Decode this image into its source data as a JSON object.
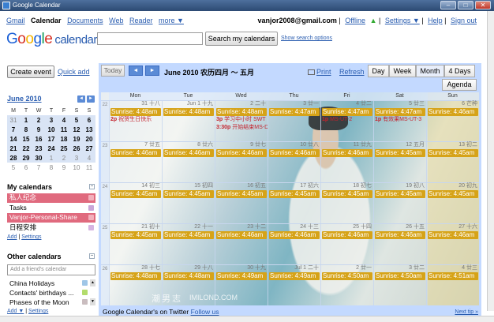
{
  "window": {
    "title": "Google Calendar",
    "min": "–",
    "max": "□",
    "close": "✕"
  },
  "topnav": {
    "items": [
      "Gmail",
      "Calendar",
      "Documents",
      "Web",
      "Reader",
      "more ▼"
    ]
  },
  "userbar": {
    "email": "vanjor2008@gmail.com",
    "offline": "Offline",
    "settings": "Settings ▼",
    "help": "Help",
    "signout": "Sign out"
  },
  "logo": {
    "g1": "G",
    "g2": "o",
    "g3": "o",
    "g4": "g",
    "g5": "l",
    "g6": "e",
    "word": "calendar"
  },
  "search": {
    "button": "Search my calendars",
    "options": "Show search options"
  },
  "sidebar": {
    "create_event": "Create event",
    "quick_add": "Quick add",
    "minical": {
      "title": "June 2010",
      "prev": "◄",
      "next": "►",
      "weekdays": [
        "M",
        "T",
        "W",
        "T",
        "F",
        "S",
        "S"
      ],
      "weeks": [
        [
          "31",
          "1",
          "2",
          "3",
          "4",
          "5",
          "6"
        ],
        [
          "7",
          "8",
          "9",
          "10",
          "11",
          "12",
          "13"
        ],
        [
          "14",
          "15",
          "16",
          "17",
          "18",
          "19",
          "20"
        ],
        [
          "21",
          "22",
          "23",
          "24",
          "25",
          "26",
          "27"
        ],
        [
          "28",
          "29",
          "30",
          "1",
          "2",
          "3",
          "4"
        ],
        [
          "5",
          "6",
          "7",
          "8",
          "9",
          "10",
          "11"
        ]
      ]
    },
    "my_calendars": {
      "title": "My calendars",
      "items": [
        {
          "label": "私人纪念",
          "color": "#e06a7e"
        },
        {
          "label": "Tasks",
          "color": "#c9a6d8"
        },
        {
          "label": "Vanjor-Personal-Share",
          "color": "#e06a7e"
        },
        {
          "label": "日程安排",
          "color": "#d6b4e2"
        }
      ],
      "add": "Add",
      "settings": "Settings"
    },
    "other_calendars": {
      "title": "Other calendars",
      "placeholder": "Add a friend's calendar",
      "items": [
        {
          "label": "China Holidays",
          "color": "#9fc6e7"
        },
        {
          "label": "Contacts' birthdays ...",
          "color": "#b3dc6c"
        },
        {
          "label": "Phases of the Moon",
          "color": "#cabdbf"
        }
      ],
      "add": "Add ▼",
      "settings": "Settings"
    }
  },
  "toolbar": {
    "today": "Today",
    "prev": "◄",
    "next": "►",
    "date_range": "June 2010 农历四月 ～ 五月",
    "print": "Print",
    "refresh": "Refresh",
    "views": [
      "Day",
      "Week",
      "Month",
      "4 Days"
    ],
    "agenda": "Agenda"
  },
  "month": {
    "weekdays": [
      "Mon",
      "Tue",
      "Wed",
      "Thu",
      "Fri",
      "Sat",
      "Sun"
    ],
    "weeks": [
      {
        "num": "22",
        "days": [
          {
            "d": "31 十八",
            "ev": "Sunrise: 4:48am",
            "x": [
              {
                "t": "2p",
                "s": "祝贺生日快乐"
              }
            ]
          },
          {
            "d": "Jun 1 十九",
            "ev": "Sunrise: 4:48am",
            "x": []
          },
          {
            "d": "2 二十",
            "ev": "Sunrise: 4:48am",
            "x": [
              {
                "t": "3p",
                "s": "学习中小时 SWT"
              },
              {
                "t": "3:30p",
                "s": "开始结束MS-D"
              }
            ]
          },
          {
            "d": "3 廿一",
            "ev": "Sunrise: 4:47am",
            "x": []
          },
          {
            "d": "4 廿二",
            "ev": "Sunrise: 4:47am",
            "x": [
              {
                "t": "1p",
                "s": "MS-UT-2"
              }
            ]
          },
          {
            "d": "5 廿三",
            "ev": "Sunrise: 4:47am",
            "x": [
              {
                "t": "1p",
                "s": "有效果MS-UT-3"
              }
            ]
          },
          {
            "d": "6 芒种",
            "ev": "Sunrise: 4:46am",
            "x": []
          }
        ]
      },
      {
        "num": "23",
        "days": [
          {
            "d": "7 廿五",
            "ev": "Sunrise: 4:46am",
            "x": []
          },
          {
            "d": "8 廿六",
            "ev": "Sunrise: 4:46am",
            "x": []
          },
          {
            "d": "9 廿七",
            "ev": "Sunrise: 4:46am",
            "x": []
          },
          {
            "d": "10 廿八",
            "ev": "Sunrise: 4:46am",
            "x": []
          },
          {
            "d": "11 廿九",
            "ev": "Sunrise: 4:46am",
            "x": []
          },
          {
            "d": "12 五月",
            "ev": "Sunrise: 4:45am",
            "x": []
          },
          {
            "d": "13 初二",
            "ev": "Sunrise: 4:45am",
            "x": []
          }
        ]
      },
      {
        "num": "24",
        "days": [
          {
            "d": "14 初三",
            "ev": "Sunrise: 4:45am",
            "x": []
          },
          {
            "d": "15 初四",
            "ev": "Sunrise: 4:45am",
            "x": []
          },
          {
            "d": "16 初五",
            "ev": "Sunrise: 4:45am",
            "x": []
          },
          {
            "d": "17 初六",
            "ev": "Sunrise: 4:45am",
            "x": []
          },
          {
            "d": "18 初七",
            "ev": "Sunrise: 4:45am",
            "x": []
          },
          {
            "d": "19 初八",
            "ev": "Sunrise: 4:45am",
            "x": []
          },
          {
            "d": "20 初九",
            "ev": "Sunrise: 4:45am",
            "x": []
          }
        ]
      },
      {
        "num": "25",
        "days": [
          {
            "d": "21 初十",
            "ev": "Sunrise: 4:45am",
            "x": []
          },
          {
            "d": "22 十一",
            "ev": "Sunrise: 4:45am",
            "x": []
          },
          {
            "d": "23 十二",
            "ev": "Sunrise: 4:46am",
            "x": []
          },
          {
            "d": "24 十三",
            "ev": "Sunrise: 4:46am",
            "x": []
          },
          {
            "d": "25 十四",
            "ev": "Sunrise: 4:46am",
            "x": []
          },
          {
            "d": "26 十五",
            "ev": "Sunrise: 4:46am",
            "x": []
          },
          {
            "d": "27 十六",
            "ev": "Sunrise: 4:46am",
            "x": []
          }
        ]
      },
      {
        "num": "26",
        "days": [
          {
            "d": "28 十七",
            "ev": "Sunrise: 4:48am",
            "x": []
          },
          {
            "d": "29 十八",
            "ev": "Sunrise: 4:48am",
            "x": []
          },
          {
            "d": "30 十九",
            "ev": "Sunrise: 4:49am",
            "x": []
          },
          {
            "d": "Jul 1 二十",
            "ev": "Sunrise: 4:49am",
            "x": []
          },
          {
            "d": "2 廿一",
            "ev": "Sunrise: 4:50am",
            "x": []
          },
          {
            "d": "3 廿二",
            "ev": "Sunrise: 4:50am",
            "x": []
          },
          {
            "d": "4 廿三",
            "ev": "Sunrise: 4:51am",
            "x": []
          }
        ]
      }
    ]
  },
  "footer": {
    "text": "Google Calendar's on Twitter",
    "follow": "Follow us",
    "next_tip": "Next tip »"
  },
  "watermark": {
    "cn": "潮男志",
    "en": "IMILOND.COM"
  }
}
